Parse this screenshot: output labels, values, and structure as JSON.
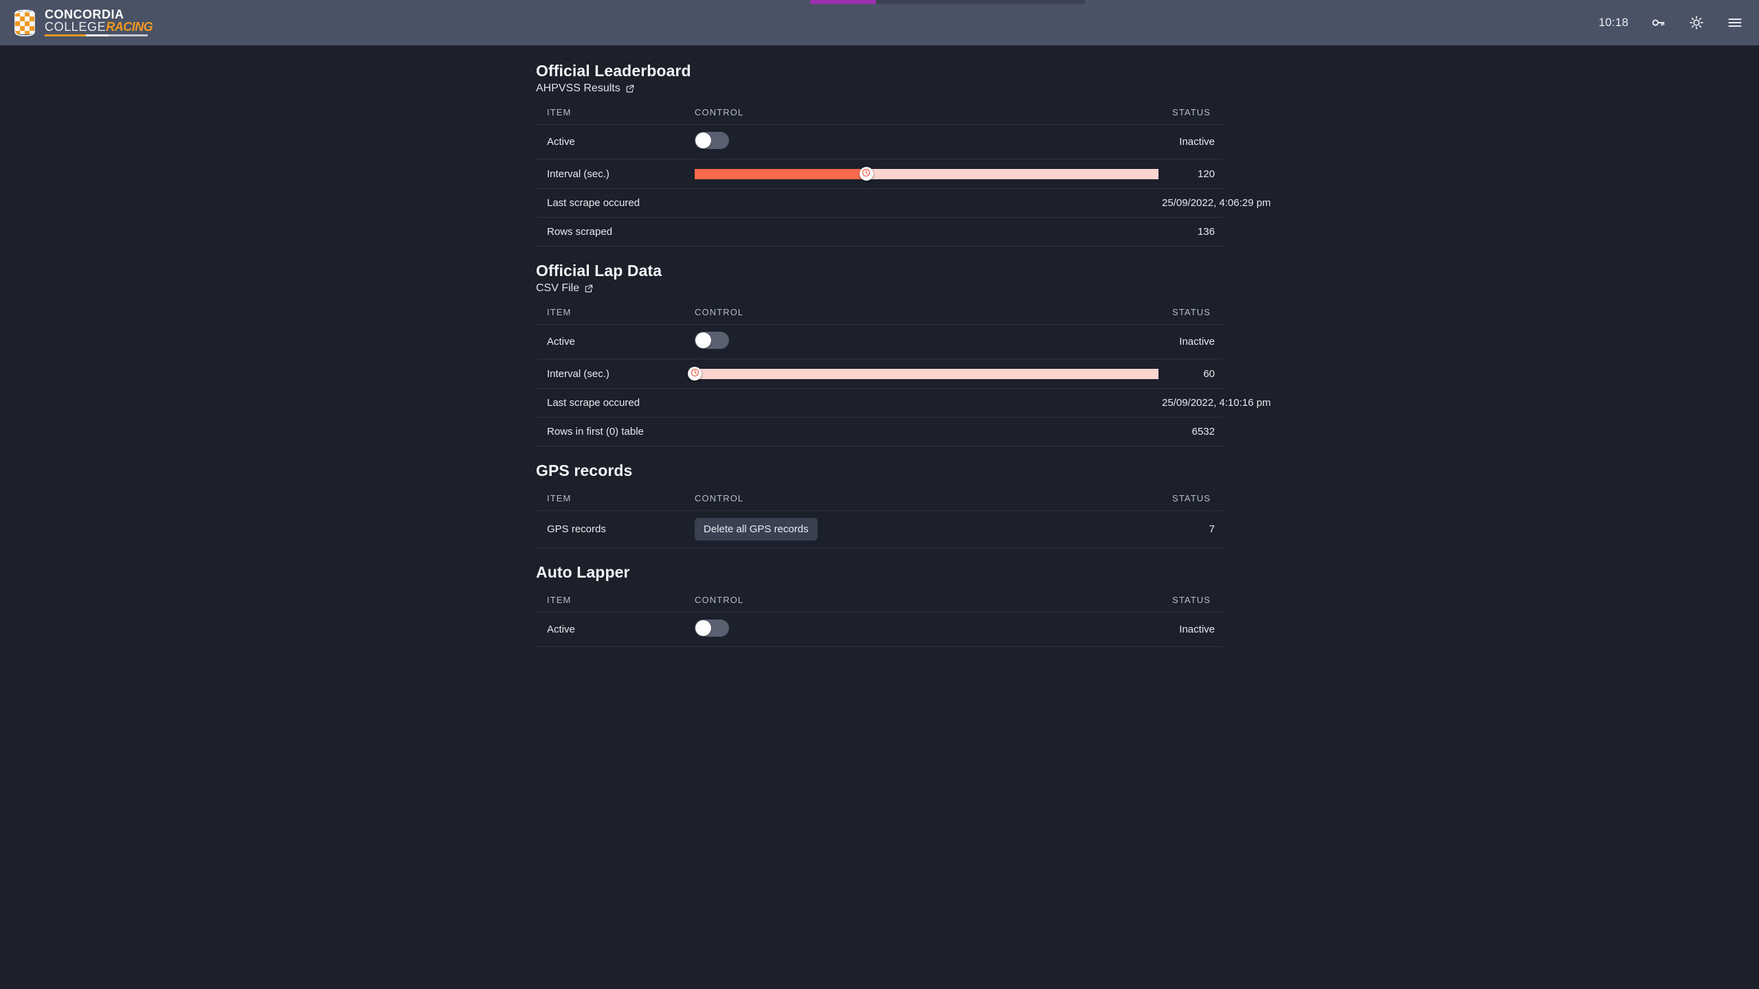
{
  "topbar": {
    "logo": {
      "line1": "CONCORDIA",
      "line2_a": "COLLEGE",
      "line2_b": "RACING"
    },
    "clock": "10:18",
    "icons": {
      "key": "key-icon",
      "brightness": "brightness-icon",
      "menu": "hamburger-menu-icon"
    }
  },
  "columns": {
    "item": "ITEM",
    "control": "CONTROL",
    "status": "STATUS"
  },
  "sections": [
    {
      "title": "Official Leaderboard",
      "subtitle": "AHPVSS Results",
      "rows": [
        {
          "item": "Active",
          "control": "toggle",
          "toggle_on": false,
          "status": "Inactive"
        },
        {
          "item": "Interval (sec.)",
          "control": "slider",
          "value": 120,
          "min": 60,
          "max": 210,
          "percent": 37,
          "status": "120"
        },
        {
          "item": "Last scrape occured",
          "control": "",
          "status": "25/09/2022, 4:06:29 pm"
        },
        {
          "item": "Rows scraped",
          "control": "",
          "status": "136"
        }
      ]
    },
    {
      "title": "Official Lap Data",
      "subtitle": "CSV File",
      "rows": [
        {
          "item": "Active",
          "control": "toggle",
          "toggle_on": false,
          "status": "Inactive"
        },
        {
          "item": "Interval (sec.)",
          "control": "slider",
          "value": 60,
          "min": 60,
          "max": 210,
          "percent": 0,
          "status": "60"
        },
        {
          "item": "Last scrape occured",
          "control": "",
          "status": "25/09/2022, 4:10:16 pm"
        },
        {
          "item": "Rows in first (0) table",
          "control": "",
          "status": "6532"
        }
      ]
    },
    {
      "title": "GPS records",
      "subtitle": "",
      "rows": [
        {
          "item": "GPS records",
          "control": "button",
          "button_label": "Delete all GPS records",
          "status": "7"
        }
      ]
    },
    {
      "title": "Auto Lapper",
      "subtitle": "",
      "rows": [
        {
          "item": "Active",
          "control": "toggle",
          "toggle_on": false,
          "status": "Inactive"
        }
      ]
    }
  ],
  "theme": {
    "page_bg": "#1b202b",
    "topbar_bg": "#4a5366",
    "accent_red": "#fb6a4c",
    "accent_red_track": "#fbd4d0",
    "accent_orange": "#f0981f",
    "progress_purple": "#9b2fae",
    "rule": "#2c3240"
  }
}
